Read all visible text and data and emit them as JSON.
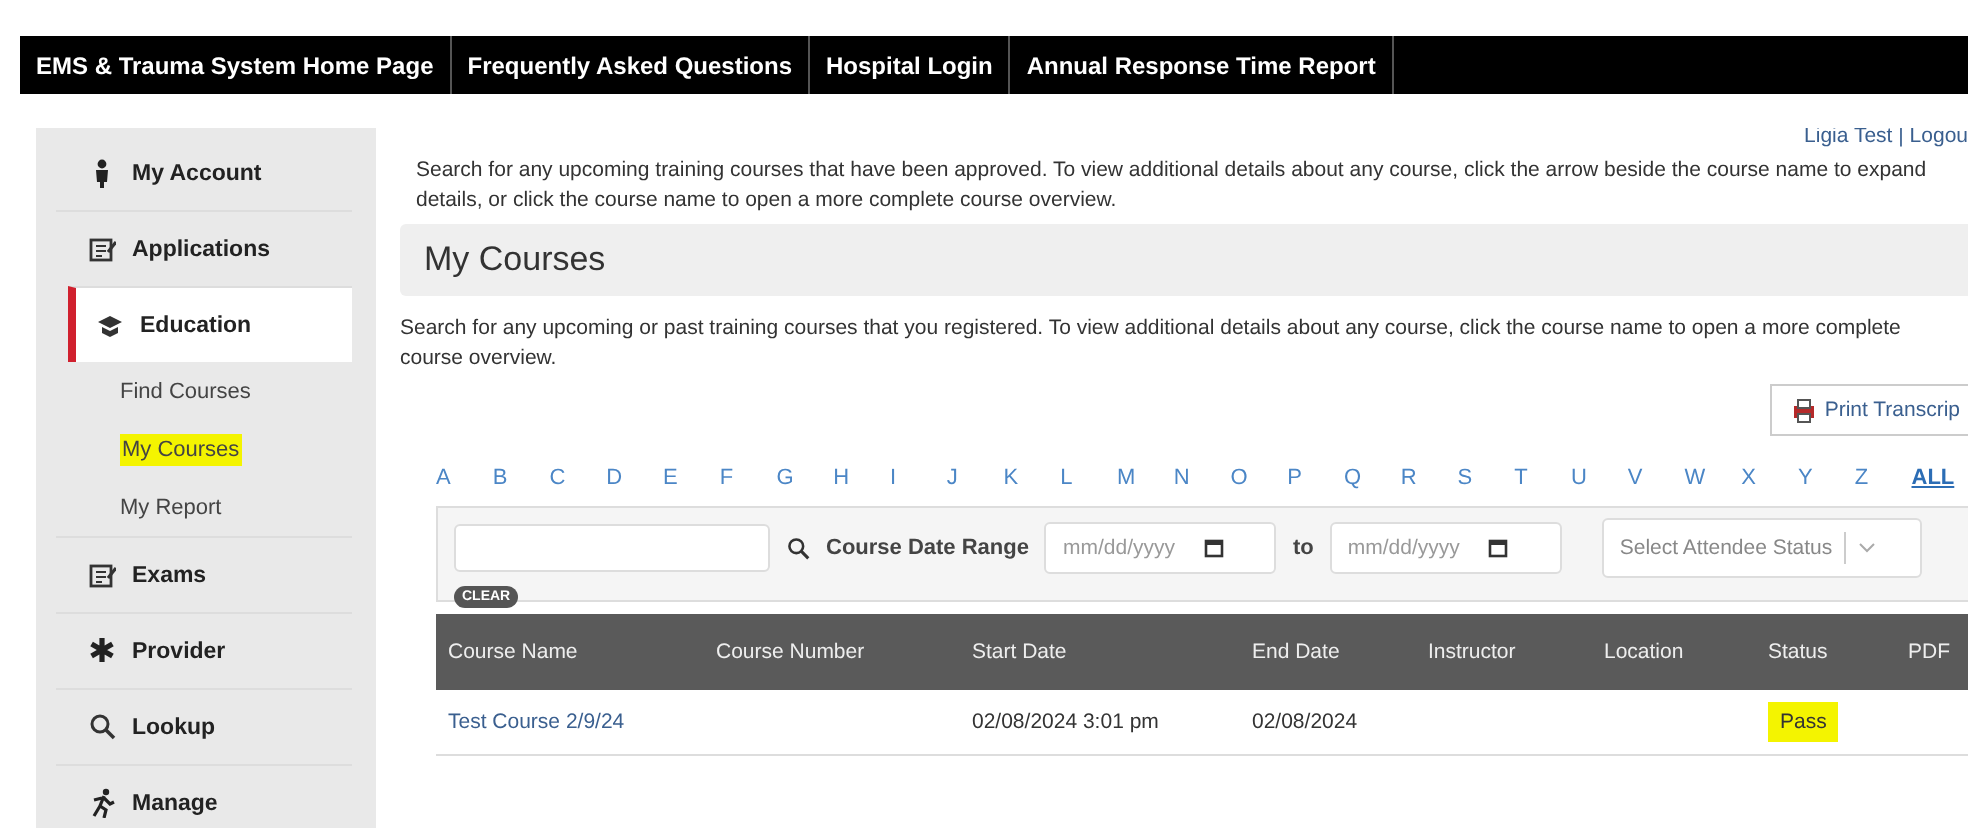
{
  "nav": [
    {
      "label": "EMS & Trauma System Home Page"
    },
    {
      "label": "Frequently Asked Questions"
    },
    {
      "label": "Hospital Login"
    },
    {
      "label": "Annual Response Time Report"
    }
  ],
  "sidebar": {
    "items": [
      {
        "label": "My Account",
        "kind": "person",
        "selected": false
      },
      {
        "label": "Applications",
        "kind": "form",
        "selected": false
      },
      {
        "label": "Education",
        "kind": "cap",
        "selected": true,
        "children": [
          {
            "label": "Find Courses",
            "highlighted": false
          },
          {
            "label": "My Courses",
            "highlighted": true
          },
          {
            "label": "My Report",
            "highlighted": false
          }
        ]
      },
      {
        "label": "Exams",
        "kind": "form",
        "selected": false
      },
      {
        "label": "Provider",
        "kind": "asterisk",
        "selected": false
      },
      {
        "label": "Lookup",
        "kind": "search",
        "selected": false
      },
      {
        "label": "Manage",
        "kind": "runner",
        "selected": false
      }
    ]
  },
  "user": {
    "name": "Ligia Test",
    "separator": "|",
    "logout": "Logou"
  },
  "intro": "Search for any upcoming training courses that have been approved. To view additional details about any course, click the arrow beside the course name to expand details, or click the course name to open a more complete course overview.",
  "section_title": "My Courses",
  "description": "Search for any upcoming or past training courses that you registered. To view additional details about any course, click the course name to open a more complete course overview.",
  "print_button": "Print Transcrip",
  "letters": [
    {
      "label": "A",
      "selected": false
    },
    {
      "label": "B",
      "selected": false
    },
    {
      "label": "C",
      "selected": false
    },
    {
      "label": "D",
      "selected": false
    },
    {
      "label": "E",
      "selected": false
    },
    {
      "label": "F",
      "selected": false
    },
    {
      "label": "G",
      "selected": false
    },
    {
      "label": "H",
      "selected": false
    },
    {
      "label": "I",
      "selected": false
    },
    {
      "label": "J",
      "selected": false
    },
    {
      "label": "K",
      "selected": false
    },
    {
      "label": "L",
      "selected": false
    },
    {
      "label": "M",
      "selected": false
    },
    {
      "label": "N",
      "selected": false
    },
    {
      "label": "O",
      "selected": false
    },
    {
      "label": "P",
      "selected": false
    },
    {
      "label": "Q",
      "selected": false
    },
    {
      "label": "R",
      "selected": false
    },
    {
      "label": "S",
      "selected": false
    },
    {
      "label": "T",
      "selected": false
    },
    {
      "label": "U",
      "selected": false
    },
    {
      "label": "V",
      "selected": false
    },
    {
      "label": "W",
      "selected": false
    },
    {
      "label": "X",
      "selected": false
    },
    {
      "label": "Y",
      "selected": false
    },
    {
      "label": "Z",
      "selected": false
    },
    {
      "label": "ALL",
      "selected": true
    }
  ],
  "filters": {
    "date_label": "Course Date Range",
    "from_placeholder": "mm/dd/yyyy",
    "to_label": "to",
    "to_placeholder": "mm/dd/yyyy",
    "status_placeholder": "Select Attendee Status",
    "clear": "CLEAR"
  },
  "table": {
    "columns": [
      "Course Name",
      "Course Number",
      "Start Date",
      "End Date",
      "Instructor",
      "Location",
      "Status",
      "PDF"
    ],
    "rows": [
      {
        "cells": [
          {
            "text": "Test Course 2/9/24",
            "highlighted": false
          },
          null,
          {
            "text": "02/08/2024 3:01 pm",
            "highlighted": false
          },
          {
            "text": "02/08/2024",
            "highlighted": false
          },
          null,
          null,
          {
            "text": "Pass",
            "highlighted": true
          },
          null
        ]
      }
    ]
  }
}
